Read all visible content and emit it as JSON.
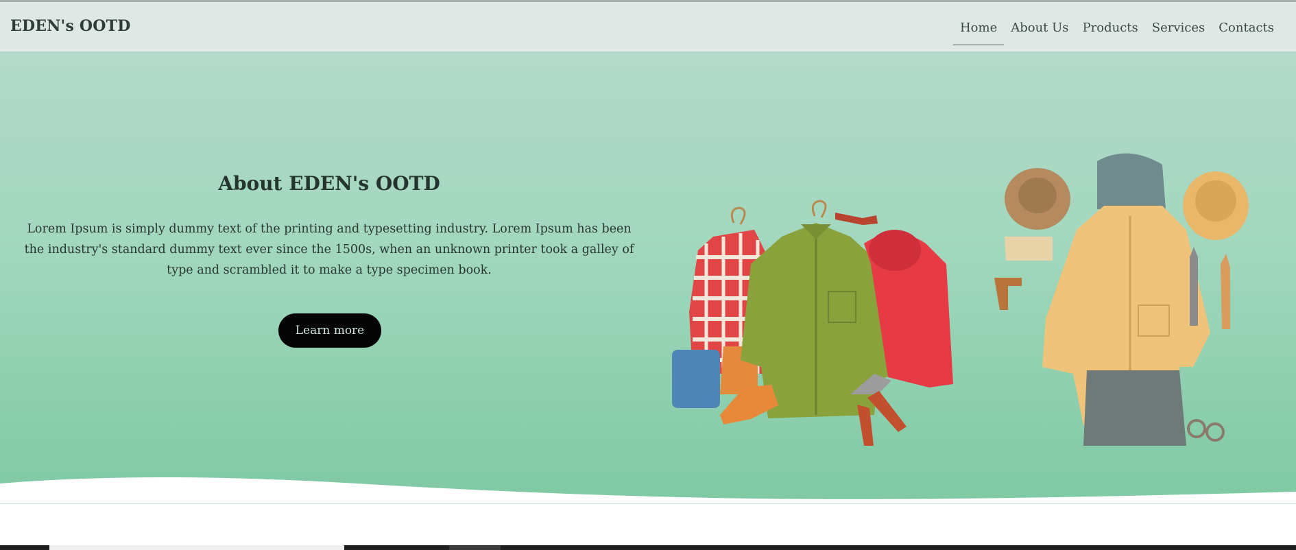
{
  "brand": "EDEN's OOTD",
  "nav": {
    "items": [
      {
        "label": "Home",
        "active": true
      },
      {
        "label": "About Us",
        "active": false
      },
      {
        "label": "Products",
        "active": false
      },
      {
        "label": "Services",
        "active": false
      },
      {
        "label": "Contacts",
        "active": false
      }
    ]
  },
  "hero": {
    "title": "About EDEN's OOTD",
    "text": "Lorem Ipsum is simply dummy text of the printing and typesetting industry. Lorem Ipsum has been the industry's standard dummy text ever since the 1500s, when an unknown printer took a galley of type and scrambled it to make a type specimen book.",
    "button_label": "Learn more",
    "illustration_name": "clothing-collage-illustration"
  },
  "colors": {
    "nav_background": "#dfe8e5",
    "hero_top": "#b3d9ca",
    "hero_bottom": "#7fc9a3",
    "button": "#050505"
  }
}
